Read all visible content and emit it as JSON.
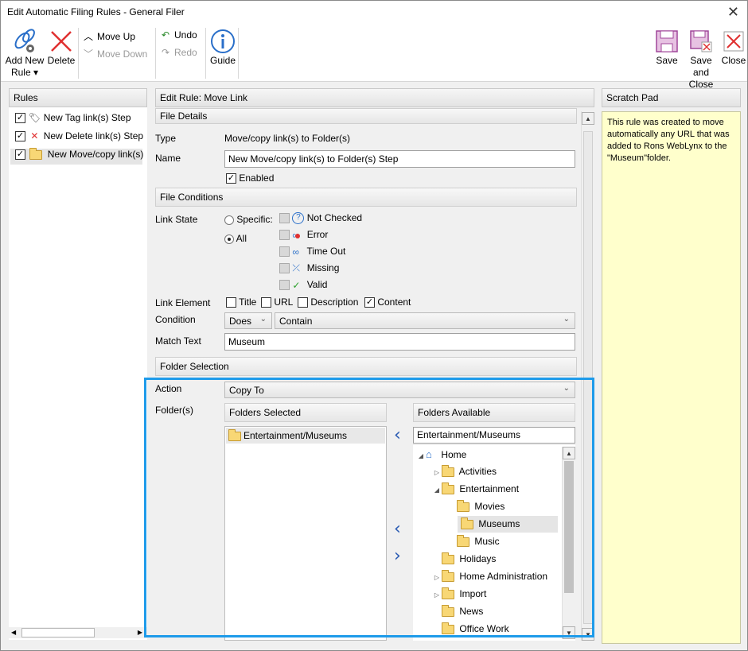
{
  "window": {
    "title": "Edit Automatic Filing Rules - General Filer"
  },
  "ribbon": {
    "add_new_rule": "Add New Rule",
    "delete": "Delete",
    "move_up": "Move Up",
    "move_down": "Move Down",
    "undo": "Undo",
    "redo": "Redo",
    "guide": "Guide",
    "save": "Save",
    "save_and_close": "Save and Close",
    "close": "Close"
  },
  "rules_panel": {
    "header": "Rules",
    "items": [
      {
        "label": "New Tag link(s) Step",
        "checked": true,
        "icon": "tag-icon"
      },
      {
        "label": "New Delete link(s) Step",
        "checked": true,
        "icon": "delete-x-icon"
      },
      {
        "label": "New Move/copy link(s)",
        "checked": true,
        "icon": "folder-icon"
      }
    ]
  },
  "editor": {
    "header": "Edit Rule: Move Link",
    "file_details": "File Details",
    "type_label": "Type",
    "type_value": "Move/copy link(s) to Folder(s)",
    "name_label": "Name",
    "name_value": "New Move/copy link(s) to Folder(s) Step",
    "enabled_label": "Enabled",
    "file_conditions": "File Conditions",
    "link_state_label": "Link State",
    "specific_label": "Specific:",
    "all_label": "All",
    "states": [
      {
        "label": "Not Checked",
        "icon": "question-icon"
      },
      {
        "label": "Error",
        "icon": "link-error-icon"
      },
      {
        "label": "Time Out",
        "icon": "link-timeout-icon"
      },
      {
        "label": "Missing",
        "icon": "broken-link-icon"
      },
      {
        "label": "Valid",
        "icon": "check-icon"
      }
    ],
    "link_element_label": "Link Element",
    "elements": [
      {
        "label": "Title",
        "checked": false
      },
      {
        "label": "URL",
        "checked": false
      },
      {
        "label": "Description",
        "checked": false
      },
      {
        "label": "Content",
        "checked": true
      }
    ],
    "condition_label": "Condition",
    "condition_op": "Does",
    "condition_value": "Contain",
    "match_text_label": "Match Text",
    "match_text_value": "Museum",
    "folder_selection": "Folder Selection",
    "action_label": "Action",
    "action_value": "Copy To",
    "folders_label": "Folder(s)",
    "folders_selected_header": "Folders Selected",
    "folders_selected": [
      "Entertainment/Museums"
    ],
    "folders_available_header": "Folders Available",
    "folders_available_search": "Entertainment/Museums",
    "tree": [
      {
        "label": "Home",
        "expander": "◢",
        "icon": "home-icon"
      },
      {
        "label": "Activities",
        "expander": "▷",
        "icon": "folder-icon"
      },
      {
        "label": "Entertainment",
        "expander": "◢",
        "icon": "folder-icon"
      },
      {
        "label": "Movies",
        "expander": "",
        "icon": "folder-icon"
      },
      {
        "label": "Museums",
        "expander": "",
        "icon": "folder-icon"
      },
      {
        "label": "Music",
        "expander": "",
        "icon": "folder-icon"
      },
      {
        "label": "Holidays",
        "expander": "",
        "icon": "folder-icon"
      },
      {
        "label": "Home Administration",
        "expander": "▷",
        "icon": "folder-icon"
      },
      {
        "label": "Import",
        "expander": "▷",
        "icon": "folder-icon"
      },
      {
        "label": "News",
        "expander": "",
        "icon": "folder-icon"
      },
      {
        "label": "Office Work",
        "expander": "",
        "icon": "folder-icon"
      }
    ]
  },
  "scratch_pad": {
    "header": "Scratch Pad",
    "text": "This rule was created to move automatically any URL that was added to Rons WebLynx to the \"Museum\"folder."
  },
  "colors": {
    "highlight": "#1e9bea",
    "scratch_bg": "#ffffcc",
    "accent": "#2a5bb3"
  }
}
